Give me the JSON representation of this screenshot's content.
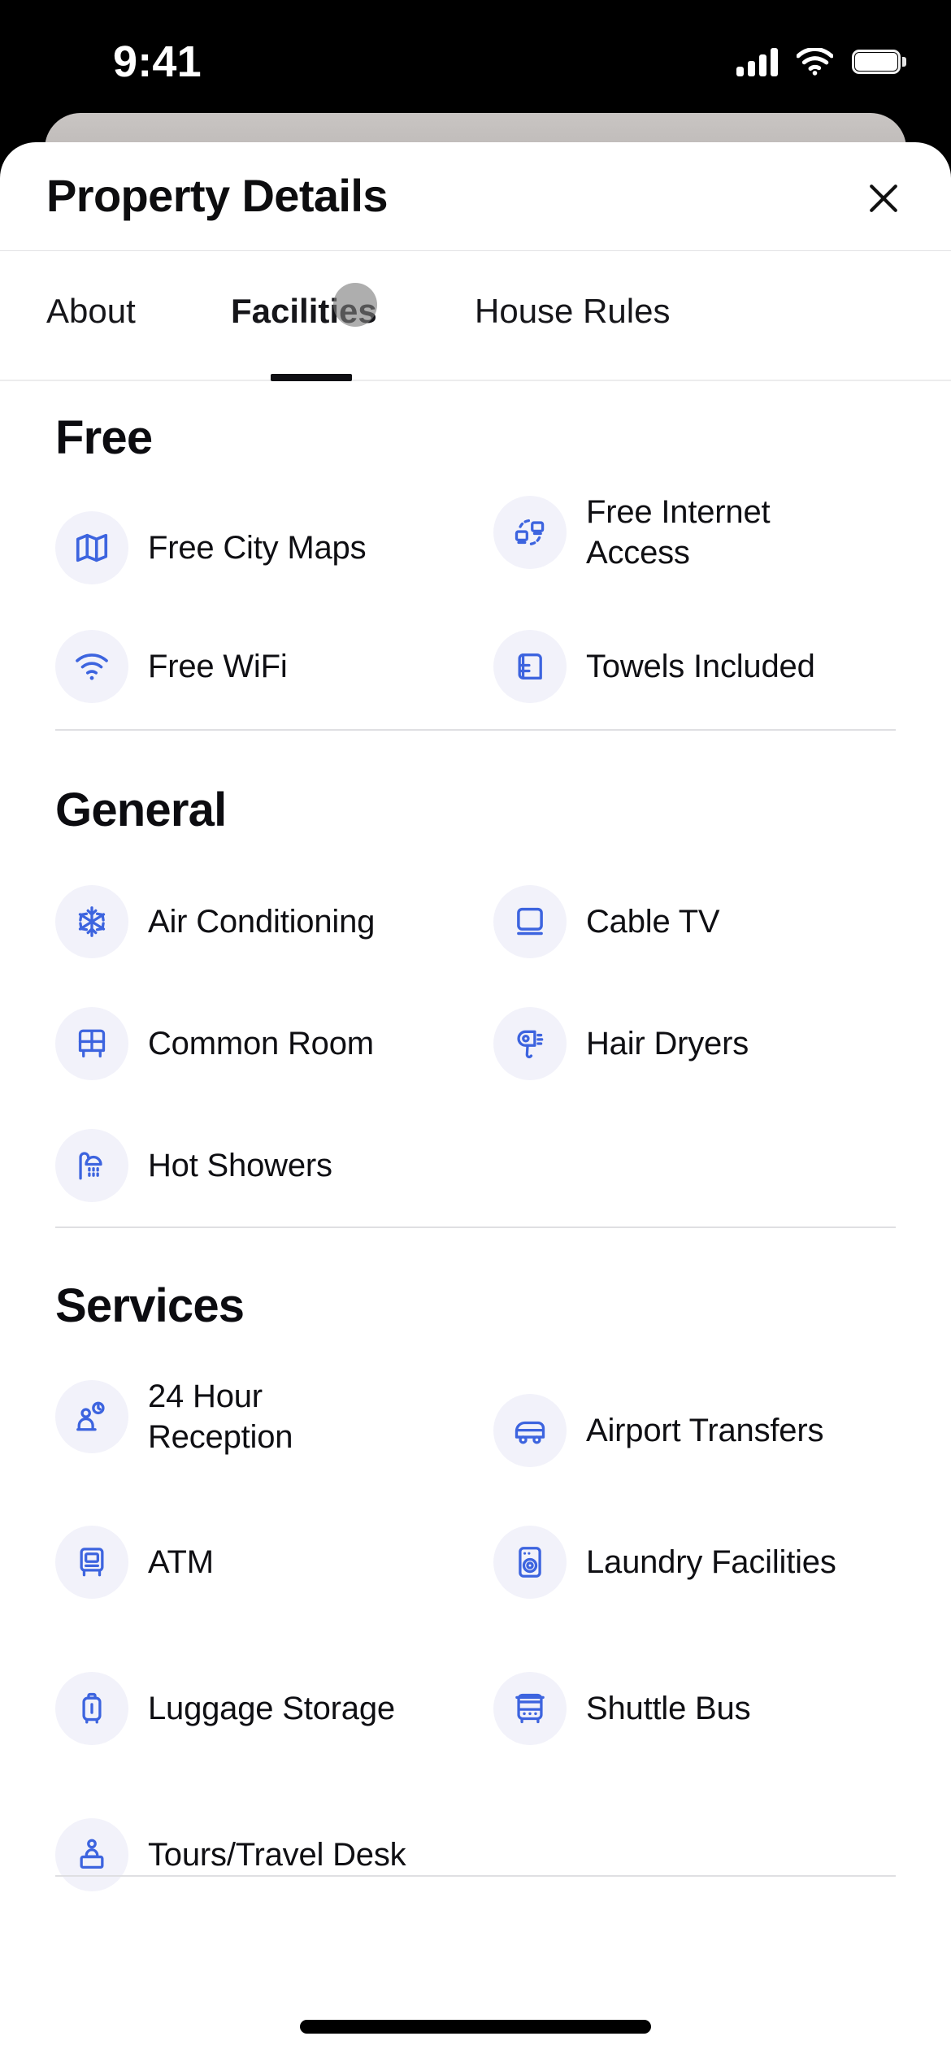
{
  "status_bar": {
    "time": "9:41",
    "cellular_icon": "cellular-signal-icon",
    "wifi_icon": "wifi-icon",
    "battery_icon": "battery-icon"
  },
  "header": {
    "title": "Property Details",
    "close_icon": "close-icon"
  },
  "tabs": {
    "items": [
      {
        "label": "About",
        "active": false
      },
      {
        "label": "Facilities",
        "active": true
      },
      {
        "label": "House Rules",
        "active": false
      }
    ]
  },
  "colors": {
    "icon_blue": "#3d64df",
    "icon_bg": "#f2f2fa",
    "text": "#0f0f13",
    "divider": "#dfdfe2",
    "sheet": "#ffffff",
    "status_bar_bg": "#000000"
  },
  "sections": [
    {
      "title": "Free",
      "items": [
        {
          "label": "Free City Maps",
          "icon": "map-icon"
        },
        {
          "label": "Free Internet Access",
          "icon": "internet-access-icon"
        },
        {
          "label": "Free WiFi",
          "icon": "wifi-icon"
        },
        {
          "label": "Towels Included",
          "icon": "towel-icon"
        }
      ]
    },
    {
      "title": "General",
      "items": [
        {
          "label": "Air Conditioning",
          "icon": "snowflake-icon"
        },
        {
          "label": "Cable TV",
          "icon": "television-icon"
        },
        {
          "label": "Common Room",
          "icon": "armchair-icon"
        },
        {
          "label": "Hair Dryers",
          "icon": "hair-dryer-icon"
        },
        {
          "label": "Hot Showers",
          "icon": "shower-icon"
        }
      ]
    },
    {
      "title": "Services",
      "items": [
        {
          "label": "24 Hour Reception",
          "icon": "reception-desk-icon"
        },
        {
          "label": "Airport Transfers",
          "icon": "shuttle-van-icon"
        },
        {
          "label": "ATM",
          "icon": "atm-icon"
        },
        {
          "label": "Laundry Facilities",
          "icon": "washing-machine-icon"
        },
        {
          "label": "Luggage Storage",
          "icon": "luggage-icon"
        },
        {
          "label": "Shuttle Bus",
          "icon": "bus-icon"
        },
        {
          "label": "Tours/Travel Desk",
          "icon": "tour-desk-icon"
        }
      ]
    }
  ],
  "home_indicator": "home-indicator",
  "touch_cursor": "touch-cursor"
}
